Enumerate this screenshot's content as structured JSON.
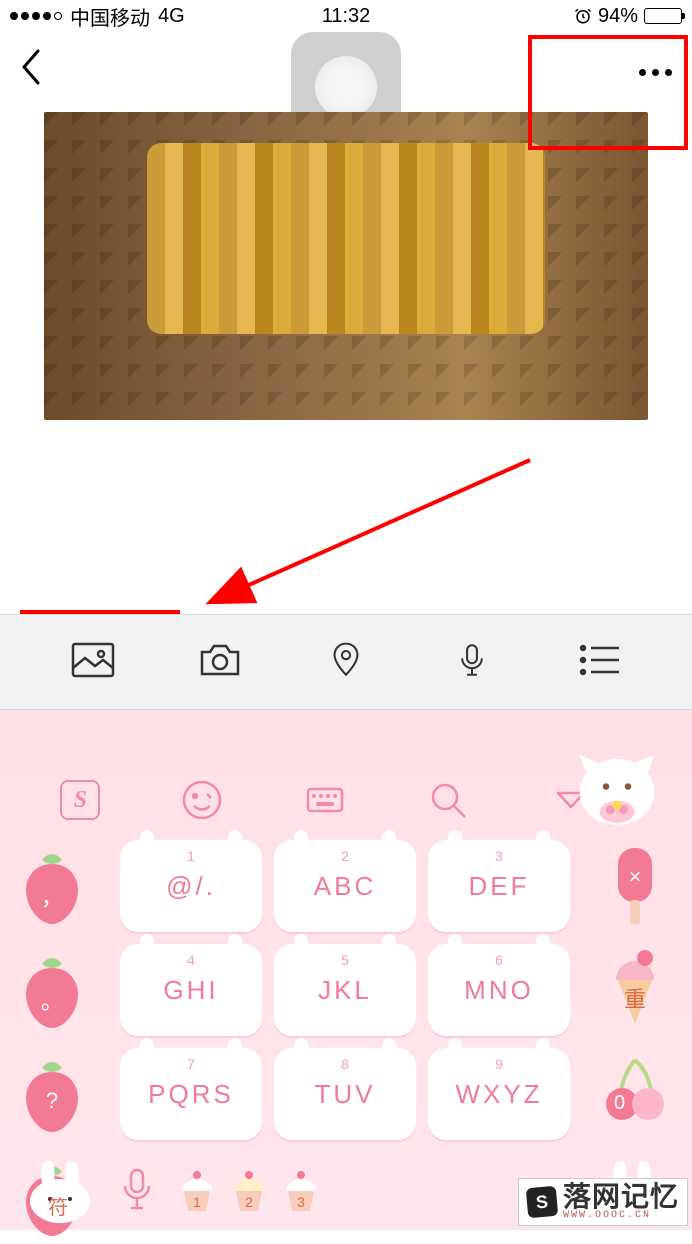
{
  "status_bar": {
    "carrier": "中国移动",
    "network": "4G",
    "time": "11:32",
    "battery_pct": "94%",
    "alarm": true
  },
  "nav": {
    "back": "‹",
    "more": "•••"
  },
  "toolbar": {
    "icons": [
      "gallery",
      "camera",
      "location",
      "voice",
      "list"
    ]
  },
  "annotations": {
    "box1": "top-right-more-button",
    "box2": "gallery-button",
    "arrow": "points-from-image-to-gallery"
  },
  "keyboard": {
    "brand": "S",
    "top_icons": [
      "emoji",
      "keyboard",
      "search",
      "dropdown"
    ],
    "keys": [
      {
        "num": "1",
        "letters": "@/."
      },
      {
        "num": "2",
        "letters": "ABC"
      },
      {
        "num": "3",
        "letters": "DEF"
      },
      {
        "num": "4",
        "letters": "GHI"
      },
      {
        "num": "5",
        "letters": "JKL"
      },
      {
        "num": "6",
        "letters": "MNO"
      },
      {
        "num": "7",
        "letters": "PQRS"
      },
      {
        "num": "8",
        "letters": "TUV"
      },
      {
        "num": "9",
        "letters": "WXYZ"
      }
    ],
    "left_col": [
      {
        "char": "，"
      },
      {
        "char": "。"
      },
      {
        "char": "?"
      },
      {
        "char": "!"
      }
    ],
    "right_col": [
      {
        "char": "×",
        "kind": "popsicle"
      },
      {
        "char": "重",
        "kind": "icecream"
      },
      {
        "char": "0",
        "kind": "cherry"
      }
    ],
    "bottom": {
      "fu": "符",
      "mic": "mic",
      "cupcakes": [
        "1",
        "2",
        "3"
      ]
    }
  },
  "watermark": {
    "main": "落网记忆",
    "sub": "WWW.OOOC.CN",
    "icon": "S"
  },
  "colors": {
    "accent_pink": "#f08aa5",
    "annotation_red": "#ff0000",
    "kb_bg": "#ffe0e6"
  }
}
